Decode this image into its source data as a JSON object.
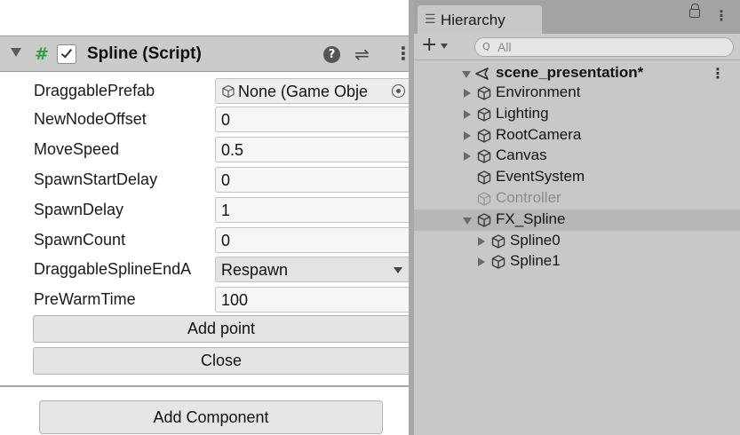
{
  "inspector": {
    "component": {
      "title": "Spline (Script)",
      "enabled": true,
      "script_icon_glyph": "#",
      "help_glyph": "?",
      "preset_glyph": "⇌",
      "menu_glyph": "⋮"
    },
    "properties": [
      {
        "label": "DraggablePrefab",
        "value": "None (Game Obje",
        "type": "object"
      },
      {
        "label": "NewNodeOffset",
        "value": "0",
        "type": "number"
      },
      {
        "label": "MoveSpeed",
        "value": "0.5",
        "type": "number"
      },
      {
        "label": "SpawnStartDelay",
        "value": "0",
        "type": "number"
      },
      {
        "label": "SpawnDelay",
        "value": "1",
        "type": "number"
      },
      {
        "label": "SpawnCount",
        "value": "0",
        "type": "number"
      },
      {
        "label": "DraggableSplineEndA",
        "value": "Respawn",
        "type": "enum"
      },
      {
        "label": "PreWarmTime",
        "value": "100",
        "type": "number"
      }
    ],
    "buttons": {
      "add_point": "Add point",
      "close": "Close"
    },
    "add_component": "Add Component"
  },
  "hierarchy": {
    "tab_label": "Hierarchy",
    "tab_icon_glyph": "☰",
    "menu_glyph": "⋮",
    "toolbar": {
      "plus_glyph": "+",
      "search_icon_glyph": "Q",
      "search_placeholder": "All"
    },
    "scene_name": "scene_presentation*",
    "items": [
      {
        "label": "Environment",
        "expandable": true,
        "expanded": false,
        "depth": 1,
        "enabled": true,
        "selected": false
      },
      {
        "label": "Lighting",
        "expandable": true,
        "expanded": false,
        "depth": 1,
        "enabled": true,
        "selected": false
      },
      {
        "label": "RootCamera",
        "expandable": true,
        "expanded": false,
        "depth": 1,
        "enabled": true,
        "selected": false
      },
      {
        "label": "Canvas",
        "expandable": true,
        "expanded": false,
        "depth": 1,
        "enabled": true,
        "selected": false
      },
      {
        "label": "EventSystem",
        "expandable": false,
        "expanded": false,
        "depth": 1,
        "enabled": true,
        "selected": false
      },
      {
        "label": "Controller",
        "expandable": false,
        "expanded": false,
        "depth": 1,
        "enabled": false,
        "selected": false
      },
      {
        "label": "FX_Spline",
        "expandable": true,
        "expanded": true,
        "depth": 1,
        "enabled": true,
        "selected": true
      },
      {
        "label": "Spline0",
        "expandable": true,
        "expanded": false,
        "depth": 2,
        "enabled": true,
        "selected": false
      },
      {
        "label": "Spline1",
        "expandable": true,
        "expanded": false,
        "depth": 2,
        "enabled": true,
        "selected": false
      }
    ]
  }
}
